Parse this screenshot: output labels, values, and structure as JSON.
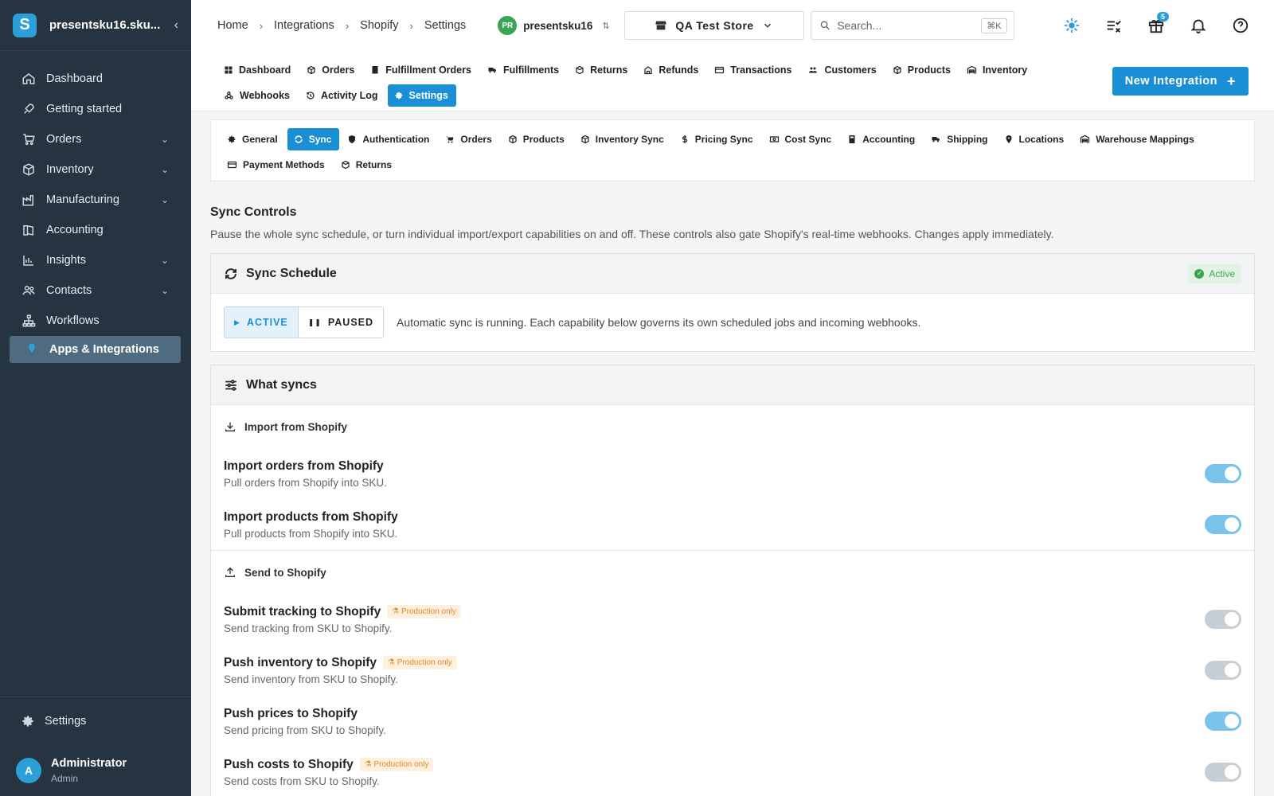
{
  "sidebar": {
    "org_name": "presentsku16.sku...",
    "collapse_icon": "chevron-left-icon",
    "items": [
      {
        "label": "Dashboard",
        "icon": "home-icon",
        "expandable": false
      },
      {
        "label": "Getting started",
        "icon": "rocket-icon",
        "expandable": false
      },
      {
        "label": "Orders",
        "icon": "cart-icon",
        "expandable": true
      },
      {
        "label": "Inventory",
        "icon": "box-icon",
        "expandable": true
      },
      {
        "label": "Manufacturing",
        "icon": "factory-icon",
        "expandable": true
      },
      {
        "label": "Accounting",
        "icon": "book-icon",
        "expandable": false
      },
      {
        "label": "Insights",
        "icon": "bar-chart-icon",
        "expandable": true
      },
      {
        "label": "Contacts",
        "icon": "people-icon",
        "expandable": true
      },
      {
        "label": "Workflows",
        "icon": "sitemap-icon",
        "expandable": false
      },
      {
        "label": "Apps & Integrations",
        "icon": "puzzle-icon",
        "expandable": false,
        "active": true
      }
    ],
    "settings_label": "Settings",
    "user": {
      "initial": "A",
      "name": "Administrator",
      "role": "Admin"
    }
  },
  "topbar": {
    "breadcrumbs": [
      "Home",
      "Integrations",
      "Shopify",
      "Settings"
    ],
    "workspace": {
      "initials": "PR",
      "name": "presentsku16"
    },
    "store": "QA Test Store",
    "search": {
      "placeholder": "Search...",
      "shortcut": "⌘K"
    },
    "notifications_badge": "5"
  },
  "integration_tabs": [
    {
      "label": "Dashboard",
      "icon": "grid-icon"
    },
    {
      "label": "Orders",
      "icon": "package-icon"
    },
    {
      "label": "Fulfillment Orders",
      "icon": "receipt-icon"
    },
    {
      "label": "Fulfillments",
      "icon": "truck-icon"
    },
    {
      "label": "Returns",
      "icon": "return-package-icon"
    },
    {
      "label": "Refunds",
      "icon": "refund-icon"
    },
    {
      "label": "Transactions",
      "icon": "credit-card-icon"
    },
    {
      "label": "Customers",
      "icon": "people-icon"
    },
    {
      "label": "Products",
      "icon": "box-icon"
    },
    {
      "label": "Inventory",
      "icon": "warehouse-icon"
    },
    {
      "label": "Webhooks",
      "icon": "webhook-icon"
    },
    {
      "label": "Activity Log",
      "icon": "history-icon"
    },
    {
      "label": "Settings",
      "icon": "gear-icon",
      "active": true
    }
  ],
  "new_integration_label": "New Integration",
  "settings_tabs": [
    {
      "label": "General",
      "icon": "gear-icon"
    },
    {
      "label": "Sync",
      "icon": "sync-icon",
      "active": true
    },
    {
      "label": "Authentication",
      "icon": "shield-icon"
    },
    {
      "label": "Orders",
      "icon": "cart-icon"
    },
    {
      "label": "Products",
      "icon": "box-icon"
    },
    {
      "label": "Inventory Sync",
      "icon": "box-icon"
    },
    {
      "label": "Pricing Sync",
      "icon": "dollar-icon"
    },
    {
      "label": "Cost Sync",
      "icon": "cash-icon"
    },
    {
      "label": "Accounting",
      "icon": "calculator-icon"
    },
    {
      "label": "Shipping",
      "icon": "truck-icon"
    },
    {
      "label": "Locations",
      "icon": "location-pin-icon"
    },
    {
      "label": "Warehouse Mappings",
      "icon": "warehouse-icon"
    },
    {
      "label": "Payment Methods",
      "icon": "credit-card-icon"
    },
    {
      "label": "Returns",
      "icon": "return-package-icon"
    }
  ],
  "sync_controls": {
    "title": "Sync Controls",
    "description": "Pause the whole sync schedule, or turn individual import/export capabilities on and off. These controls also gate Shopify's real-time webhooks. Changes apply immediately."
  },
  "sync_schedule": {
    "title": "Sync Schedule",
    "status": "Active",
    "active_label": "ACTIVE",
    "paused_label": "PAUSED",
    "selected": "ACTIVE",
    "description": "Automatic sync is running. Each capability below governs its own scheduled jobs and incoming webhooks."
  },
  "what_syncs": {
    "title": "What syncs",
    "import_group": {
      "title": "Import from Shopify",
      "items": [
        {
          "title": "Import orders from Shopify",
          "desc": "Pull orders from Shopify into SKU.",
          "enabled": true
        },
        {
          "title": "Import products from Shopify",
          "desc": "Pull products from Shopify into SKU.",
          "enabled": true
        }
      ]
    },
    "send_group": {
      "title": "Send to Shopify",
      "items": [
        {
          "title": "Submit tracking to Shopify",
          "badge": "Production only",
          "desc": "Send tracking from SKU to Shopify.",
          "enabled": false
        },
        {
          "title": "Push inventory to Shopify",
          "badge": "Production only",
          "desc": "Send inventory from SKU to Shopify.",
          "enabled": false
        },
        {
          "title": "Push prices to Shopify",
          "desc": "Send pricing from SKU to Shopify.",
          "enabled": true
        },
        {
          "title": "Push costs to Shopify",
          "badge": "Production only",
          "desc": "Send costs from SKU to Shopify.",
          "enabled": false
        }
      ]
    }
  },
  "colors": {
    "sidebar_bg": "#263340",
    "accent": "#1a8fd6",
    "success": "#3aa655",
    "warning": "#e08a1e"
  }
}
